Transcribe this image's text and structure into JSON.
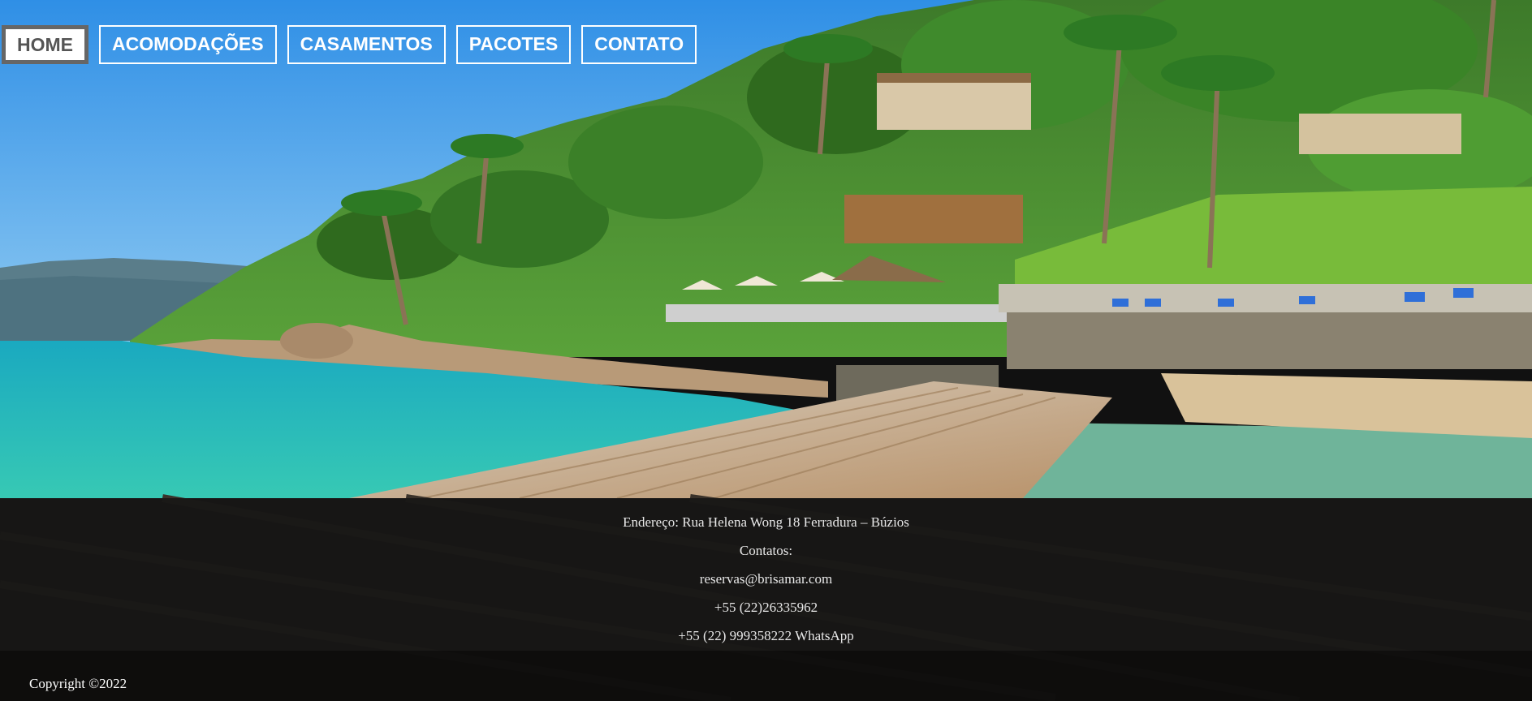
{
  "nav": {
    "items": [
      {
        "label": "HOME"
      },
      {
        "label": "ACOMODAÇÕES"
      },
      {
        "label": "CASAMENTOS"
      },
      {
        "label": "PACOTES"
      },
      {
        "label": "CONTATO"
      }
    ]
  },
  "footer": {
    "address": "Endereço: Rua Helena Wong 18 Ferradura – Búzios",
    "contacts_label": "Contatos:",
    "email": "reservas@brisamar.com",
    "phone": "+55 (22)26335962",
    "whatsapp": "+55 (22) 999358222 WhatsApp",
    "copyright": "Copyright ©2022"
  },
  "colors": {
    "sky": "#5aaeea",
    "sea": "#1fb3b8",
    "footer_bg": "#141414",
    "nav_border": "#ffffff"
  }
}
